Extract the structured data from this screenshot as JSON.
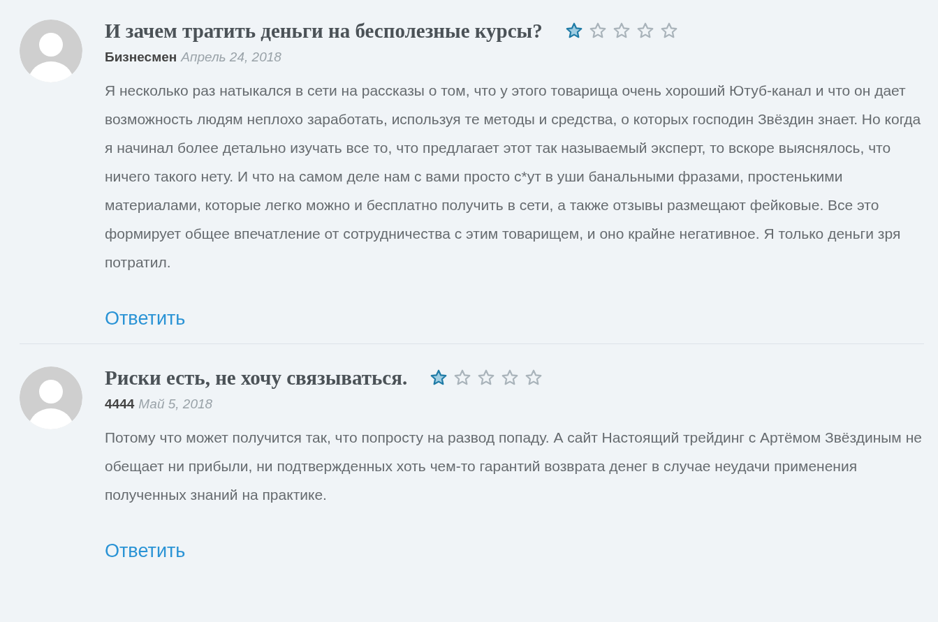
{
  "comments": [
    {
      "title": "И зачем тратить деньги на бесполезные курсы?",
      "stars": 1,
      "author": "Бизнесмен",
      "date": "Апрель 24, 2018",
      "text": "Я несколько раз натыкался в сети на рассказы о том, что у этого товарища очень хороший Ютуб-канал и что он дает возможность людям неплохо заработать, используя те методы и средства, о которых господин Звёздин знает. Но когда я начинал более детально изучать все то, что предлагает этот так называемый эксперт, то вскоре выяснялось, что ничего такого нету. И что на самом деле нам с вами просто с*ут в уши банальными фразами, простенькими материалами, которые легко можно и бесплатно получить в сети, а также отзывы размещают фейковые. Все это формирует общее впечатление от сотрудничества с этим товарищем, и оно крайне негативное. Я только деньги зря потратил.",
      "reply": "Ответить"
    },
    {
      "title": "Риски есть, не хочу связываться.",
      "stars": 1,
      "author": "4444",
      "date": "Май 5, 2018",
      "text": "Потому что может получится так, что попросту на развод попаду. А сайт Настоящий трейдинг с Артёмом Звёздиным не обещает ни прибыли, ни подтвержденных хоть чем-то гарантий возврата денег в случае неудачи применения полученных знаний на практике.",
      "reply": "Ответить"
    }
  ]
}
